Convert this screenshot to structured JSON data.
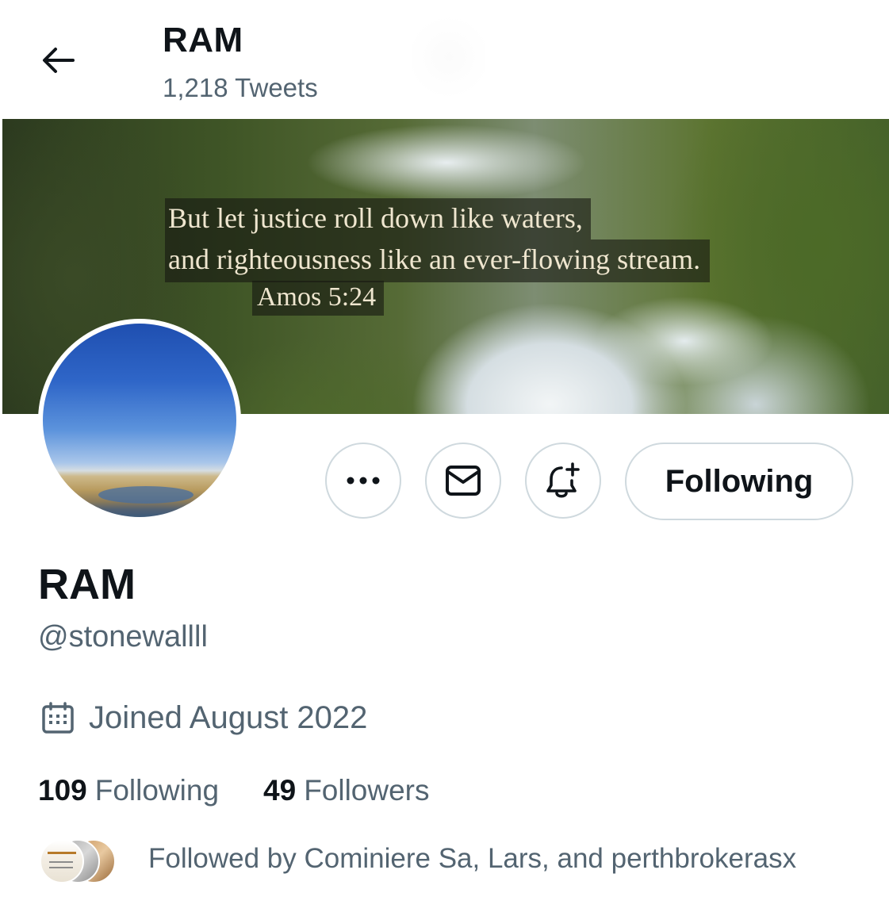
{
  "header": {
    "title": "RAM",
    "tweet_count": "1,218 Tweets"
  },
  "banner": {
    "quote_line1": "But let justice roll down like waters,",
    "quote_line2": "and righteousness like an ever-flowing stream.",
    "quote_ref": "Amos 5:24"
  },
  "actions": {
    "more_icon": "more-icon",
    "message_icon": "envelope-icon",
    "notify_icon": "bell-plus-icon",
    "follow_label": "Following"
  },
  "profile": {
    "name": "RAM",
    "handle": "@stonewallll",
    "joined": "Joined August 2022"
  },
  "stats": {
    "following_count": "109",
    "following_label": "Following",
    "followers_count": "49",
    "followers_label": "Followers"
  },
  "followed_by": {
    "text": "Followed by Cominiere Sa, Lars, and perthbrokerasx"
  },
  "colors": {
    "text_primary": "#0f1419",
    "text_secondary": "#536471",
    "border": "#cfd9de"
  }
}
